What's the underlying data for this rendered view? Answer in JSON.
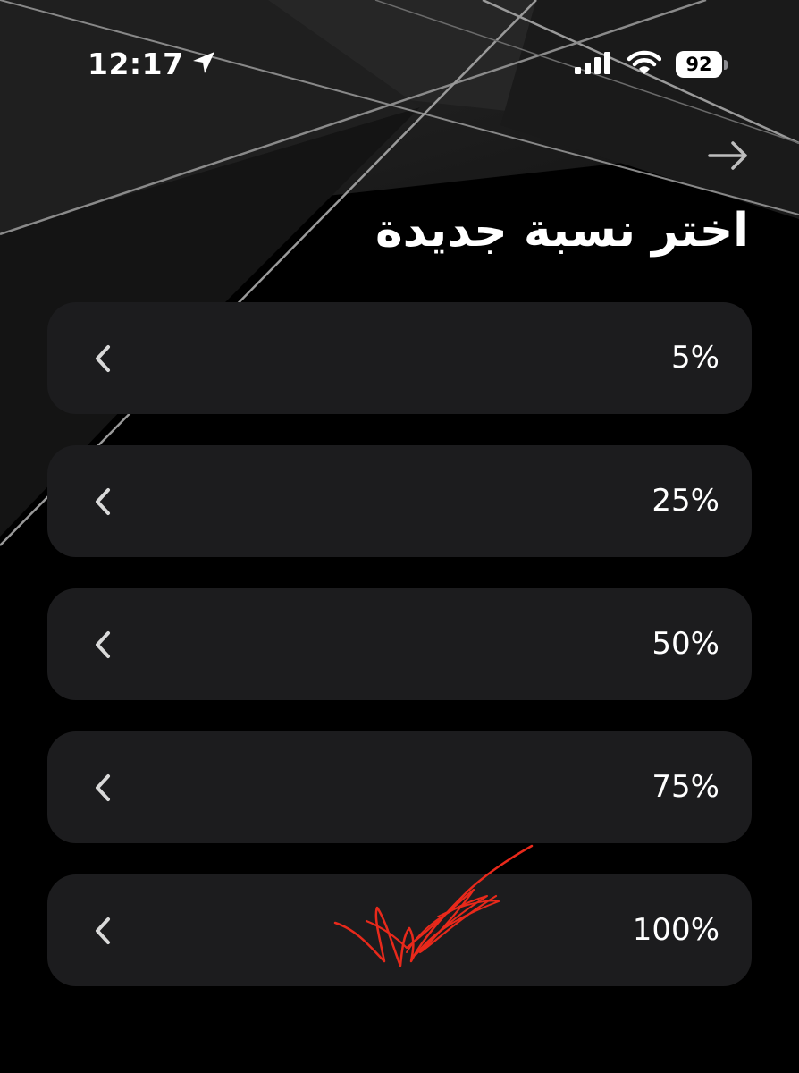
{
  "status_bar": {
    "time": "12:17",
    "battery_level": "92",
    "icons": [
      "location-arrow-icon",
      "cellular-signal-icon",
      "wifi-icon",
      "battery-icon"
    ]
  },
  "header": {
    "back_icon": "arrow-right-icon",
    "title": "اختر نسبة جديدة"
  },
  "options": [
    {
      "label": "5%",
      "icon": "chevron-left-icon"
    },
    {
      "label": "25%",
      "icon": "chevron-left-icon"
    },
    {
      "label": "50%",
      "icon": "chevron-left-icon"
    },
    {
      "label": "75%",
      "icon": "chevron-left-icon"
    },
    {
      "label": "100%",
      "icon": "chevron-left-icon"
    }
  ],
  "colors": {
    "background": "#000000",
    "card": "#1c1c1e",
    "text": "#ffffff",
    "chevron": "#d9d9d9",
    "annotation": "#e8291b"
  }
}
